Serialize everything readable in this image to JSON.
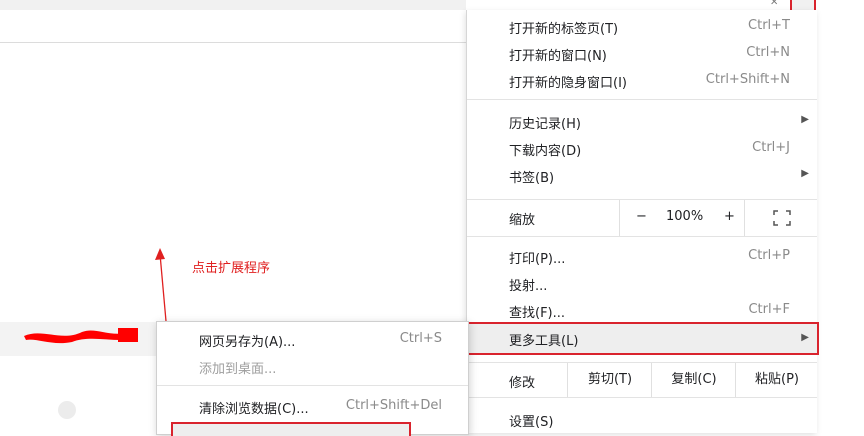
{
  "annotation": {
    "text": "点击扩展程序",
    "color": "#e02020"
  },
  "menu": {
    "items_group1": [
      {
        "label": "打开新的标签页(T)",
        "shortcut": "Ctrl+T"
      },
      {
        "label": "打开新的窗口(N)",
        "shortcut": "Ctrl+N"
      },
      {
        "label": "打开新的隐身窗口(I)",
        "shortcut": "Ctrl+Shift+N"
      }
    ],
    "items_group2": [
      {
        "label": "历史记录(H)",
        "shortcut": ""
      },
      {
        "label": "下载内容(D)",
        "shortcut": "Ctrl+J"
      },
      {
        "label": "书签(B)",
        "shortcut": ""
      }
    ],
    "zoom": {
      "label": "缩放",
      "minus": "−",
      "value": "100%",
      "plus": "+"
    },
    "items_group3": [
      {
        "label": "打印(P)...",
        "shortcut": "Ctrl+P"
      },
      {
        "label": "投射...",
        "shortcut": ""
      },
      {
        "label": "查找(F)...",
        "shortcut": "Ctrl+F"
      }
    ],
    "more_tools": {
      "label": "更多工具(L)"
    },
    "edit": {
      "label": "修改",
      "cut": "剪切(T)",
      "copy": "复制(C)",
      "paste": "粘贴(P)"
    },
    "settings": {
      "label": "设置(S)"
    }
  },
  "submenu": {
    "items": [
      {
        "label": "网页另存为(A)...",
        "shortcut": "Ctrl+S"
      },
      {
        "label": "添加到桌面...",
        "shortcut": ""
      },
      {
        "label": "清除浏览数据(C)...",
        "shortcut": "Ctrl+Shift+Del"
      }
    ]
  },
  "colors": {
    "highlight_border": "#d9232d",
    "annotation": "#e02020"
  }
}
